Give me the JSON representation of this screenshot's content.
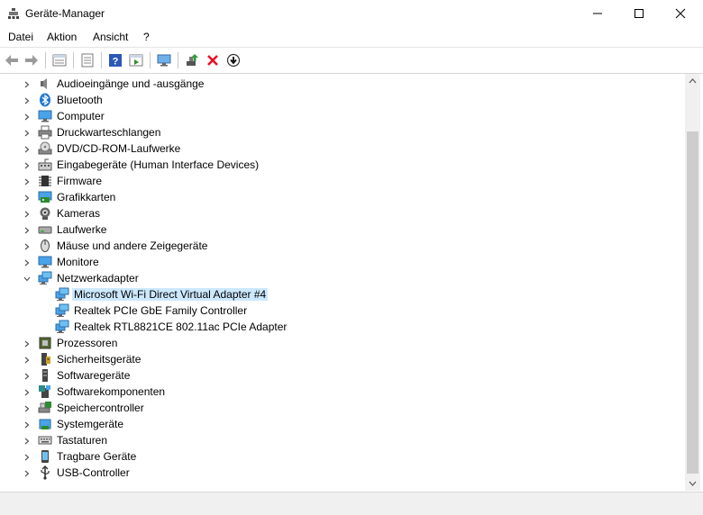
{
  "window": {
    "title": "Geräte-Manager",
    "icon": "device-manager-icon"
  },
  "menu": {
    "items": [
      "Datei",
      "Aktion",
      "Ansicht",
      "?"
    ]
  },
  "toolbar": {
    "buttons": [
      "back-icon",
      "forward-icon",
      "properties-list-icon",
      "properties-sheet-icon",
      "help-icon",
      "run-icon",
      "monitor-scan-icon",
      "update-driver-icon",
      "uninstall-icon",
      "download-icon"
    ]
  },
  "tree": {
    "categories": [
      {
        "label": "Audioeingänge und -ausgänge",
        "icon": "speaker-icon"
      },
      {
        "label": "Bluetooth",
        "icon": "bluetooth-icon"
      },
      {
        "label": "Computer",
        "icon": "computer-icon"
      },
      {
        "label": "Druckwarteschlangen",
        "icon": "printer-icon"
      },
      {
        "label": "DVD/CD-ROM-Laufwerke",
        "icon": "disc-drive-icon"
      },
      {
        "label": "Eingabegeräte (Human Interface Devices)",
        "icon": "hid-icon"
      },
      {
        "label": "Firmware",
        "icon": "chip-icon"
      },
      {
        "label": "Grafikkarten",
        "icon": "display-adapter-icon"
      },
      {
        "label": "Kameras",
        "icon": "camera-icon"
      },
      {
        "label": "Laufwerke",
        "icon": "disk-drive-icon"
      },
      {
        "label": "Mäuse und andere Zeigegeräte",
        "icon": "mouse-icon"
      },
      {
        "label": "Monitore",
        "icon": "monitor-icon"
      },
      {
        "label": "Netzwerkadapter",
        "icon": "network-icon",
        "expanded": true
      },
      {
        "label": "Prozessoren",
        "icon": "processor-icon"
      },
      {
        "label": "Sicherheitsgeräte",
        "icon": "security-device-icon"
      },
      {
        "label": "Softwaregeräte",
        "icon": "software-device-icon"
      },
      {
        "label": "Softwarekomponenten",
        "icon": "software-component-icon"
      },
      {
        "label": "Speichercontroller",
        "icon": "storage-controller-icon"
      },
      {
        "label": "Systemgeräte",
        "icon": "system-device-icon"
      },
      {
        "label": "Tastaturen",
        "icon": "keyboard-icon"
      },
      {
        "label": "Tragbare Geräte",
        "icon": "portable-device-icon"
      },
      {
        "label": "USB-Controller",
        "icon": "usb-icon"
      }
    ],
    "network_children": [
      {
        "label": "Microsoft Wi-Fi Direct Virtual Adapter #4",
        "selected": true
      },
      {
        "label": "Realtek PCIe GbE Family Controller",
        "selected": false
      },
      {
        "label": "Realtek RTL8821CE 802.11ac PCIe Adapter",
        "selected": false
      }
    ]
  },
  "colors": {
    "selection": "#cce8ff",
    "accent_blue": "#1e78d4",
    "delete_red": "#e81123"
  }
}
